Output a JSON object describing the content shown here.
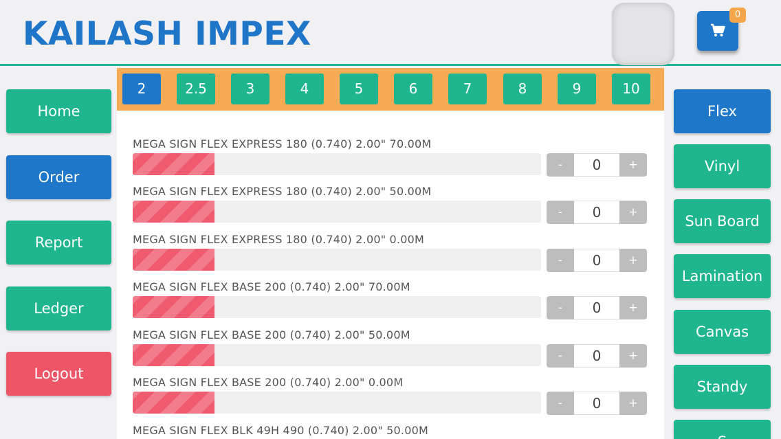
{
  "header": {
    "brand": "KAILASH IMPEX",
    "cart_count": "0"
  },
  "left_nav": [
    {
      "label": "Home"
    },
    {
      "label": "Order"
    },
    {
      "label": "Report"
    },
    {
      "label": "Ledger"
    },
    {
      "label": "Logout"
    }
  ],
  "sizes": [
    "2",
    "2.5",
    "3",
    "4",
    "5",
    "6",
    "7",
    "8",
    "9",
    "10"
  ],
  "selected_size": "2",
  "items": [
    {
      "title": "MEGA SIGN FLEX EXPRESS 180 (0.740) 2.00\" 70.00M",
      "qty": "0",
      "minus": "-",
      "plus": "+"
    },
    {
      "title": "MEGA SIGN FLEX EXPRESS 180 (0.740) 2.00\" 50.00M",
      "qty": "0",
      "minus": "-",
      "plus": "+"
    },
    {
      "title": "MEGA SIGN FLEX EXPRESS 180 (0.740) 2.00\" 0.00M",
      "qty": "0",
      "minus": "-",
      "plus": "+"
    },
    {
      "title": "MEGA SIGN FLEX BASE 200 (0.740) 2.00\" 70.00M",
      "qty": "0",
      "minus": "-",
      "plus": "+"
    },
    {
      "title": "MEGA SIGN FLEX BASE 200 (0.740) 2.00\" 50.00M",
      "qty": "0",
      "minus": "-",
      "plus": "+"
    },
    {
      "title": "MEGA SIGN FLEX BASE 200 (0.740) 2.00\" 0.00M",
      "qty": "0",
      "minus": "-",
      "plus": "+"
    },
    {
      "title": "MEGA SIGN FLEX BLK 49H 490 (0.740) 2.00\" 50.00M"
    }
  ],
  "stock_fill_fraction": 0.2,
  "categories": [
    {
      "label": "Flex"
    },
    {
      "label": "Vinyl"
    },
    {
      "label": "Sun Board"
    },
    {
      "label": "Lamination"
    },
    {
      "label": "Canvas"
    },
    {
      "label": "Standy"
    },
    {
      "label": "S"
    }
  ],
  "colors": {
    "brand_blue": "#1e77c8",
    "green": "#1fb58f",
    "red": "#ee5667",
    "orange": "#f7ab55"
  },
  "icons": {
    "cart": "shopping-cart-icon"
  }
}
